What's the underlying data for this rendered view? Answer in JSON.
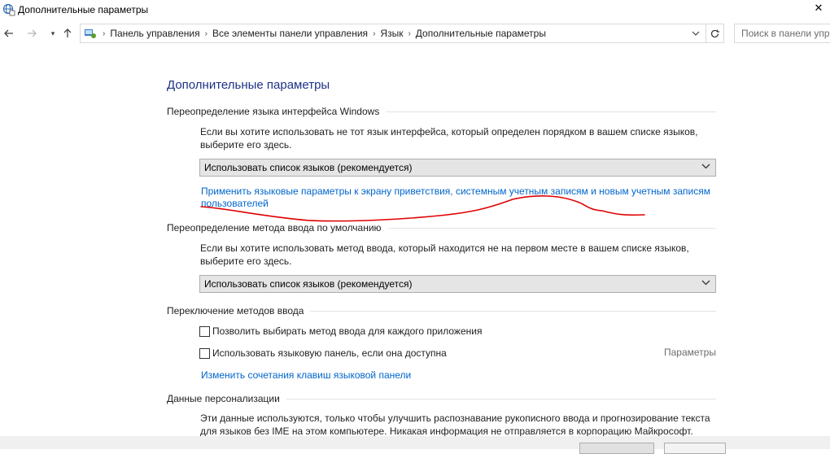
{
  "window": {
    "title": "Дополнительные параметры"
  },
  "nav": {
    "breadcrumbs": [
      "Панель управления",
      "Все элементы панели управления",
      "Язык",
      "Дополнительные параметры"
    ],
    "search_placeholder": "Поиск в панели упр"
  },
  "content": {
    "title": "Дополнительные параметры",
    "section1": {
      "heading": "Переопределение языка интерфейса Windows",
      "desc_line1": "Если вы хотите использовать не тот язык интерфейса, который определен порядком в вашем списке языков,",
      "desc_line2": "выберите его здесь.",
      "select_value": "Использовать список языков (рекомендуется)",
      "link_line1": "Применить языковые параметры к экрану приветствия, системным учетным записям и новым учетным записям",
      "link_line2": "пользователей"
    },
    "section2": {
      "heading": "Переопределение метода ввода по умолчанию",
      "desc_line1": "Если вы хотите использовать метод ввода, который находится не на первом месте в вашем списке языков,",
      "desc_line2": "выберите его здесь.",
      "select_value": "Использовать список языков (рекомендуется)"
    },
    "section3": {
      "heading": "Переключение методов ввода",
      "checkbox1": "Позволить выбирать метод ввода для каждого приложения",
      "checkbox2": "Использовать языковую панель, если она доступна",
      "params_link": "Параметры",
      "hotkeys_link": "Изменить сочетания клавиш языковой панели"
    },
    "section4": {
      "heading": "Данные персонализации",
      "desc_line1": "Эти данные используются, только чтобы улучшить распознавание рукописного ввода и прогнозирование текста",
      "desc_line2": "для языков без IME на этом компьютере. Никакая информация не отправляется в корпорацию Майкрософт."
    }
  },
  "colors": {
    "title_blue": "#1e3287",
    "link_blue": "#0066cc",
    "annotation_red": "#e00000"
  }
}
